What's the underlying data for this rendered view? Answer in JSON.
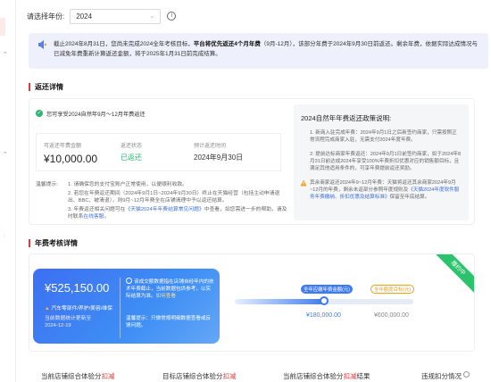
{
  "header": {
    "year_label": "请选择年份:",
    "year_value": "2024"
  },
  "notice": {
    "text_before": "截止2024年8月31日，您尚未完成2024全年考核目标，",
    "bold": "平台将优先返还4个月年费",
    "text_after": "（9月-12月），该部分年费于2024年9月30日前返还。剩余年费，依据实际达成情况与已减免年费重新计算返还金额，将于2025年1月31日前完成结算。"
  },
  "rebate": {
    "section_title": "返还详情",
    "status_text": "您可享受2024自然年9月～12月年费返还",
    "stats": [
      {
        "key": "可返还年费金额",
        "value": "¥10,000.00"
      },
      {
        "key": "返还状态",
        "value": "已返还"
      },
      {
        "key": "预计返还时间",
        "value": "2024年9月30日"
      }
    ],
    "notes_label": "温馨提示:",
    "notes": [
      "1. 请确保您的支付宝账户正常使用，以便顺利收款。",
      "2. 若您在年费返还期间（2024年9月1日~2024年9月30日）终止在天猫经营（包括主动申请退出、BBC、被清退），则9月~12月年费全在店铺清理中予以返还结算。",
      "3. 年费返还相关问题可在",
      "《天猫2024年年费结算常见问题》",
      "中查看，如您需进一步的帮助，请及时联系",
      "在线客服",
      "。"
    ],
    "policy": {
      "title": "2024自然年年费返还政策说明:",
      "item1": "1. 新商入驻完成年费：2024年9月1日之后新签约商家，只需按照正常流程完成商家入驻，无需支付2024年度年费。",
      "item2": "2. 提前达标商家年费返还：2024年9月1日前签约商家，如于2024年8月31日前达成2024年享受100%年费折扣优惠对应的销售额目标，且满足其他适用条件的，可享年费提前返还奖励。",
      "item3_before": "其余商家返还2024年9~12月年费：天猫将返还其余商家2024年9月~12月的年费，剩余未返部分参照年度规则及",
      "item3_link": "《天猫2024年度软件服务年费缴纳、折扣优惠及结算标准》",
      "item3_after": "保留至年底结算。"
    }
  },
  "fee": {
    "section_title": "年费考核详情",
    "ribbon": "履约中",
    "amount": "¥525,150.00",
    "tag": "汽车零部件/养护/美容/维保",
    "update_label": "当前数据统计更新至",
    "update_date": "2024-12-19",
    "right_top_prefix": "该成交额数据指在店铺自经年内的技术年费截止，当前数据包供参考，以实际结算为准。",
    "right_top_link": "如何查看",
    "right_bottom": "温馨提示：只做常规明细数据查看或反馈问题。",
    "progress": {
      "label_current": "全年应缴年费金额(元)",
      "label_target": "全年额度目标(元)",
      "value_current": "¥180,000.00",
      "value_target": "¥600,000.00",
      "fill_fraction": 0.5
    }
  },
  "bottom": {
    "c1_a": "当前店铺综合体验分",
    "c1_b": "扣减",
    "c2_a": "目标店铺综合体验分",
    "c2_b": "扣减",
    "c3_a": "当前店铺综合体验分",
    "c3_b": "扣减",
    "c3_c": "结果",
    "c4": "违规扣分情况"
  }
}
